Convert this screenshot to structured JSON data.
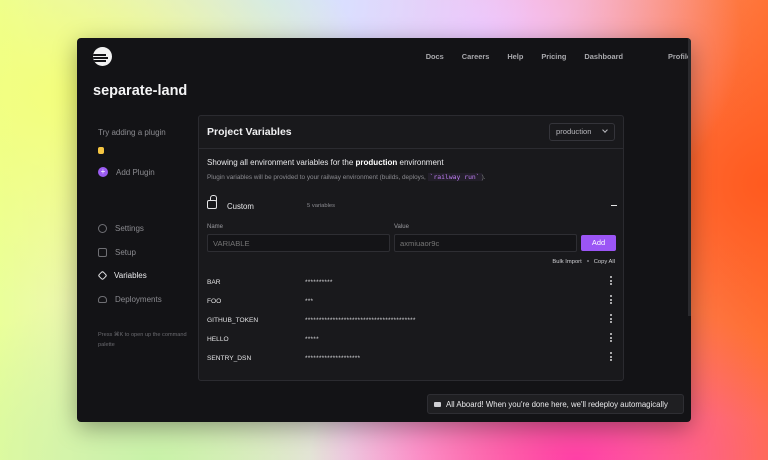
{
  "nav": {
    "items": [
      "Docs",
      "Careers",
      "Help",
      "Pricing",
      "Dashboard"
    ],
    "profile": "Profile"
  },
  "project": {
    "title": "separate-land"
  },
  "sidebar": {
    "hint": "Try adding a plugin",
    "add_plugin": "Add Plugin",
    "items": [
      {
        "label": "Settings",
        "icon": "gear-icon"
      },
      {
        "label": "Setup",
        "icon": "book-icon"
      },
      {
        "label": "Variables",
        "icon": "cube-icon",
        "active": true
      },
      {
        "label": "Deployments",
        "icon": "cloud-icon"
      }
    ],
    "command_hint": "Press ⌘K to open up the command palette"
  },
  "panel": {
    "title": "Project Variables",
    "environment": "production",
    "description_prefix": "Showing all environment variables for the ",
    "description_env": "production",
    "description_suffix": " environment",
    "subdescription_prefix": "Plugin variables will be provided to your railway environment (builds, deploys, ",
    "subdescription_code": "`railway run`",
    "subdescription_suffix": ").",
    "group_name": "Custom",
    "var_count": "5 variables",
    "name_label": "Name",
    "value_label": "Value",
    "name_placeholder": "VARIABLE",
    "value_placeholder": "axmiuaor9c",
    "add_label": "Add",
    "bulk_import": "Bulk Import",
    "copy_all": "Copy All",
    "variables": [
      {
        "key": "BAR",
        "value": "**********"
      },
      {
        "key": "FOO",
        "value": "***"
      },
      {
        "key": "GITHUB_TOKEN",
        "value": "****************************************"
      },
      {
        "key": "HELLO",
        "value": "*****"
      },
      {
        "key": "SENTRY_DSN",
        "value": "********************"
      }
    ]
  },
  "toast": {
    "text": "All Aboard! When you're done here, we'll redeploy automagically"
  },
  "colors": {
    "accent": "#9b55f5",
    "background": "#131316"
  }
}
